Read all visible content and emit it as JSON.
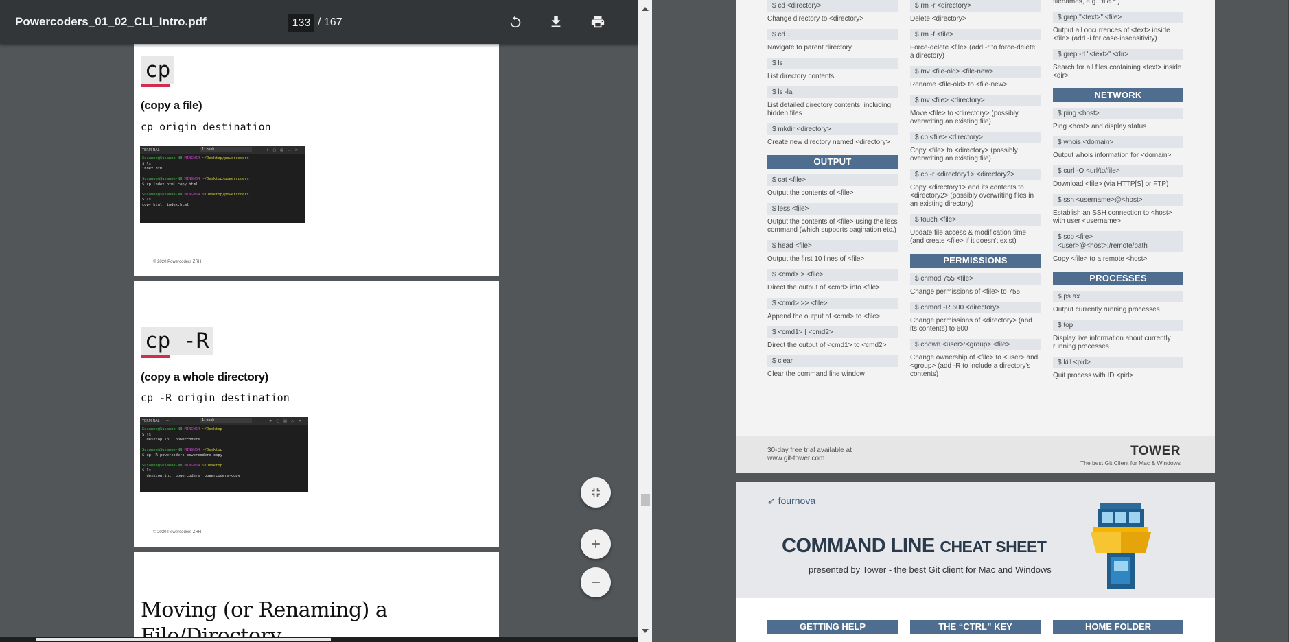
{
  "viewer": {
    "doc_title": "Powercoders_01_02_CLI_Intro.pdf",
    "page_current": "133",
    "page_total": "/ 167",
    "icons": [
      "rotate-icon",
      "download-icon",
      "print-icon"
    ]
  },
  "pages": [
    {
      "title": "cp",
      "subhead": "(copy a file)",
      "command": "cp origin destination",
      "terminal": {
        "label": "TERMINAL",
        "dots": "···",
        "shell": "1: bash",
        "lines": [
          {
            "user": "Susanne@Susanne-NB",
            "ming": "MINGW64",
            "path": "~/Desktop/powercoders"
          },
          {
            "text": "$ ls"
          },
          {
            "text": "index.html"
          },
          {
            "text": ""
          },
          {
            "user": "Susanne@Susanne-NB",
            "ming": "MINGW64",
            "path": "~/Desktop/powercoders"
          },
          {
            "text": "$ cp index.html copy.html"
          },
          {
            "text": ""
          },
          {
            "user": "Susanne@Susanne-NB",
            "ming": "MINGW64",
            "path": "~/Desktop/powercoders"
          },
          {
            "text": "$ ls"
          },
          {
            "text": "copy.html  index.html"
          }
        ]
      },
      "footer": "© 2020 Powercoders ZRH"
    },
    {
      "title": "cp -R",
      "subhead": "(copy a whole directory)",
      "command": "cp -R origin destination",
      "terminal": {
        "label": "TERMINAL",
        "dots": "···",
        "shell": "1: bash",
        "lines": [
          {
            "user": "Susanne@Susanne-NB",
            "ming": "MINGW64",
            "path": "~/Desktop"
          },
          {
            "text": "$ ls"
          },
          {
            "text": "  desktop.ini  powercoders"
          },
          {
            "text": ""
          },
          {
            "user": "Susanne@Susanne-NB",
            "ming": "MINGW64",
            "path": "~/Desktop"
          },
          {
            "text": "$ cp -R powercoders powercoders-copy"
          },
          {
            "text": ""
          },
          {
            "user": "Susanne@Susanne-NB",
            "ming": "MINGW64",
            "path": "~/Desktop"
          },
          {
            "text": "$ ls"
          },
          {
            "text": "  desktop.ini  powercoders  powercoders-copy"
          }
        ]
      },
      "footer": "© 2020 Powercoders ZRH"
    },
    {
      "title": "Moving (or Renaming) a File/Directory"
    }
  ],
  "cheatsheet": {
    "col1": [
      {
        "cmd": "$ cd <directory>",
        "desc": "Change directory to <directory>"
      },
      {
        "cmd": "$ cd ..",
        "desc": "Navigate to parent directory"
      },
      {
        "cmd": "$ ls",
        "desc": "List directory contents"
      },
      {
        "cmd": "$ ls -la",
        "desc": "List detailed directory contents, including hidden files"
      },
      {
        "cmd": "$ mkdir <directory>",
        "desc": "Create new directory named <directory>"
      },
      {
        "section": "OUTPUT"
      },
      {
        "cmd": "$ cat <file>",
        "desc": "Output the contents of <file>"
      },
      {
        "cmd": "$ less <file>",
        "desc": "Output the contents of <file> using the less command (which supports pagination etc.)"
      },
      {
        "cmd": "$ head <file>",
        "desc": "Output the first 10 lines of <file>"
      },
      {
        "cmd": "$ <cmd> > <file>",
        "desc": "Direct the output of <cmd> into <file>"
      },
      {
        "cmd": "$ <cmd> >> <file>",
        "desc": "Append the output of <cmd> to <file>"
      },
      {
        "cmd": "$ <cmd1> | <cmd2>",
        "desc": "Direct the output of <cmd1> to <cmd2>"
      },
      {
        "cmd": "$ clear",
        "desc": "Clear the command line window"
      }
    ],
    "col2": [
      {
        "cmd": "$ rm -r <directory>",
        "desc": "Delete <directory>"
      },
      {
        "cmd": "$ rm -f <file>",
        "desc": "Force-delete <file> (add -r to force-delete a directory)"
      },
      {
        "cmd": "$ mv <file-old> <file-new>",
        "desc": "Rename <file-old> to <file-new>"
      },
      {
        "cmd": "$ mv <file> <directory>",
        "desc": "Move <file> to <directory> (possibly overwriting an existing file)"
      },
      {
        "cmd": "$ cp <file> <directory>",
        "desc": "Copy <file> to <directory> (possibly overwriting an existing file)"
      },
      {
        "cmd": "$ cp -r <directory1> <directory2>",
        "desc": "Copy <directory1> and its contents to <directory2> (possibly overwriting files in an existing directory)"
      },
      {
        "cmd": "$ touch <file>",
        "desc": "Update file access & modification time (and create <file> if it doesn't exist)"
      },
      {
        "section": "PERMISSIONS"
      },
      {
        "cmd": "$ chmod 755 <file>",
        "desc": "Change permissions of <file> to 755"
      },
      {
        "cmd": "$ chmod -R 600 <directory>",
        "desc": "Change permissions of <directory> (and its contents) to 600"
      },
      {
        "cmd": "$ chown <user>:<group> <file>",
        "desc": "Change ownership of <file> to <user> and <group> (add -R to include a directory's contents)"
      }
    ],
    "col3": [
      {
        "desc": "filenames, e.g. \"file.*\")"
      },
      {
        "cmd": "$ grep \"<text>\" <file>",
        "desc": "Output all occurrences of <text> inside <file> (add -i for case-insensitivity)"
      },
      {
        "cmd": "$ grep -rl \"<text>\" <dir>",
        "desc": "Search for all files containing <text> inside <dir>"
      },
      {
        "section": "NETWORK"
      },
      {
        "cmd": "$ ping <host>",
        "desc": "Ping <host> and display status"
      },
      {
        "cmd": "$ whois <domain>",
        "desc": "Output whois information for <domain>"
      },
      {
        "cmd": "$ curl -O <url/to/file>",
        "desc": "Download <file> (via HTTP[S] or FTP)"
      },
      {
        "cmd": "$ ssh <username>@<host>",
        "desc": "Establish an SSH connection to <host> with user <username>"
      },
      {
        "cmd": "$ scp <file> <user>@<host>:/remote/path",
        "desc": "Copy <file> to a remote <host>"
      },
      {
        "section": "PROCESSES"
      },
      {
        "cmd": "$ ps ax",
        "desc": "Output currently running processes"
      },
      {
        "cmd": "$ top",
        "desc": "Display live information about currently running processes"
      },
      {
        "cmd": "$ kill <pid>",
        "desc": "Quit process with ID <pid>"
      }
    ],
    "footer": {
      "trial_line1": "30-day free trial available at",
      "trial_line2": "www.git-tower.com",
      "brand": "TOWER",
      "tagline": "The best Git Client for Mac & Windows"
    },
    "page2": {
      "company": "fournova",
      "title_big": "COMMAND LINE",
      "title_small": "CHEAT SHEET",
      "subtitle": "presented by Tower - the best Git client for Mac and Windows",
      "sections": [
        "GETTING HELP",
        "THE “CTRL” KEY",
        "HOME FOLDER"
      ]
    }
  },
  "colors": {
    "toolbar": "#323639",
    "viewer_bg": "#525659",
    "section_blue": "#4f6d8e",
    "underline_red": "#d12e4f"
  }
}
